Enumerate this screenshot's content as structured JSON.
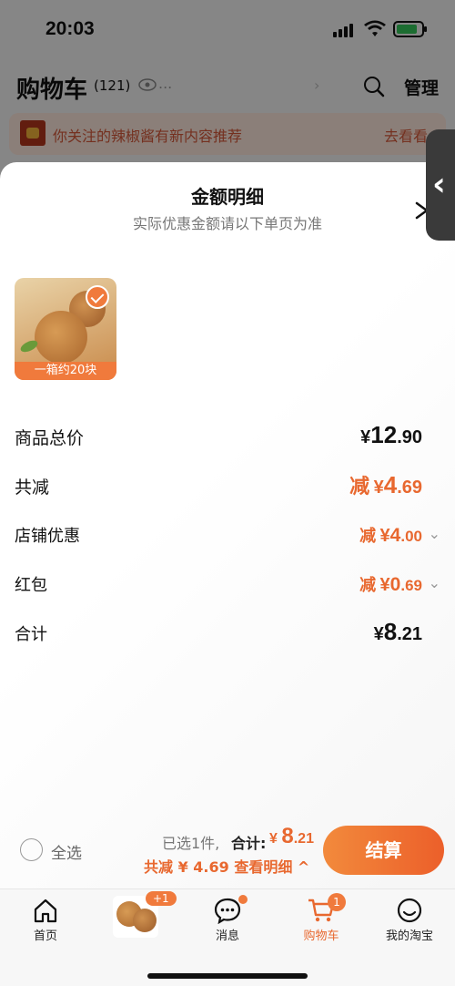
{
  "status_bar": {
    "time": "20:03"
  },
  "background": {
    "title": "购物车",
    "count": "(121)",
    "dots": "...",
    "manage": "管理",
    "notice_text": "你关注的辣椒酱有新内容推荐",
    "notice_link": "去看看"
  },
  "sheet": {
    "title": "金额明细",
    "subtitle": "实际优惠金额请以下单页为准",
    "product_label": "一箱约20块",
    "rows": [
      {
        "label": "商品总价",
        "prefix": "",
        "currency": "¥",
        "int": "12",
        "dec": ".90"
      },
      {
        "label": "共减",
        "prefix": "减",
        "currency": "¥",
        "int": "4",
        "dec": ".69"
      },
      {
        "label": "店铺优惠",
        "prefix": "减",
        "currency": "¥",
        "int": "4",
        "dec": ".00"
      },
      {
        "label": "红包",
        "prefix": "减",
        "currency": "¥",
        "int": "0",
        "dec": ".69"
      },
      {
        "label": "合计",
        "prefix": "",
        "currency": "¥",
        "int": "8",
        "dec": ".21"
      }
    ]
  },
  "checkout": {
    "select_all": "全选",
    "selected_count": "已选1件,",
    "total_label": "合计:",
    "total_currency": "¥",
    "total_int": "8",
    "total_dec": ".21",
    "discount_line": "共减 ¥ 4.69  查看明细 ^",
    "button": "结算"
  },
  "tabbar": {
    "home": "首页",
    "plus_badge": "+1",
    "messages": "消息",
    "cart": "购物车",
    "cart_badge": "1",
    "mine": "我的淘宝"
  },
  "colors": {
    "accent": "#e8682f",
    "accent_light": "#f07a3c"
  }
}
